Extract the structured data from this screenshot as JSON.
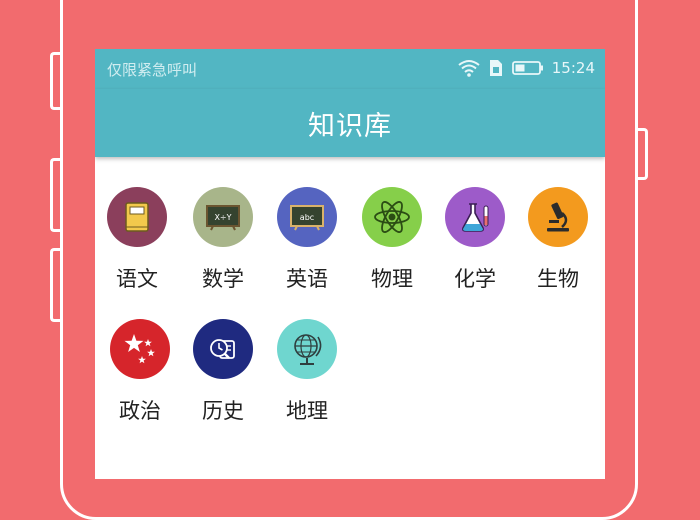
{
  "status_bar": {
    "carrier": "仅限紧急呼叫",
    "time": "15:24",
    "icons": [
      "wifi-icon",
      "sim-icon",
      "battery-icon"
    ]
  },
  "app_bar": {
    "title": "知识库"
  },
  "subjects": [
    {
      "label": "语文",
      "icon": "book-icon",
      "color": "#8b3f5c"
    },
    {
      "label": "数学",
      "icon": "chalkboard-icon",
      "color": "#a8b58a"
    },
    {
      "label": "英语",
      "icon": "chalkboard-icon",
      "color": "#5564c0"
    },
    {
      "label": "物理",
      "icon": "atom-icon",
      "color": "#86cf4a"
    },
    {
      "label": "化学",
      "icon": "flask-icon",
      "color": "#9d5bc9"
    },
    {
      "label": "生物",
      "icon": "microscope-icon",
      "color": "#f39a1e"
    },
    {
      "label": "政治",
      "icon": "star-flag-icon",
      "color": "#d6252b"
    },
    {
      "label": "历史",
      "icon": "history-icon",
      "color": "#1f2a80"
    },
    {
      "label": "地理",
      "icon": "globe-icon",
      "color": "#6fd6cf"
    }
  ]
}
